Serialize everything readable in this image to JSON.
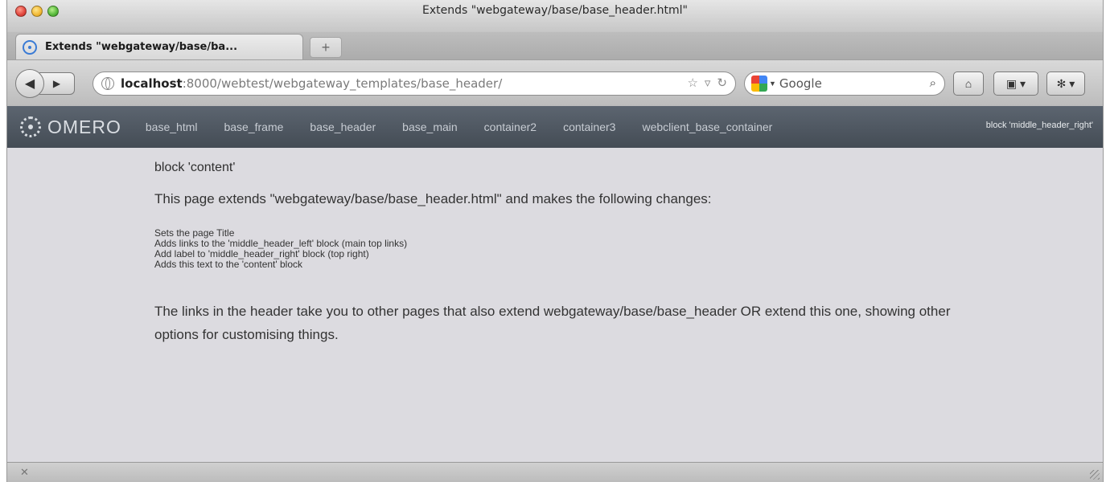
{
  "window": {
    "title": "Extends \"webgateway/base/base_header.html\""
  },
  "tab": {
    "label": "Extends \"webgateway/base/ba..."
  },
  "newtab": {
    "label": "+"
  },
  "url": {
    "host": "localhost",
    "rest": ":8000/webtest/webgateway_templates/base_header/"
  },
  "search": {
    "placeholder": "Google"
  },
  "header": {
    "logo": "OMERO",
    "links": [
      "base_html",
      "base_frame",
      "base_header",
      "base_main",
      "container2",
      "container3",
      "webclient_base_container"
    ],
    "right_label": "block 'middle_header_right'"
  },
  "content": {
    "heading": "block 'content'",
    "intro": "This page extends \"webgateway/base/base_header.html\" and makes the following changes:",
    "changes": [
      "Sets the page Title",
      "Adds links to the 'middle_header_left' block (main top links)",
      "Add label to 'middle_header_right' block (top right)",
      "Adds this text to the 'content' block"
    ],
    "paragraph": "The links in the header take you to other pages that also extend webgateway/base/base_header OR extend this one, showing other options for customising things."
  }
}
